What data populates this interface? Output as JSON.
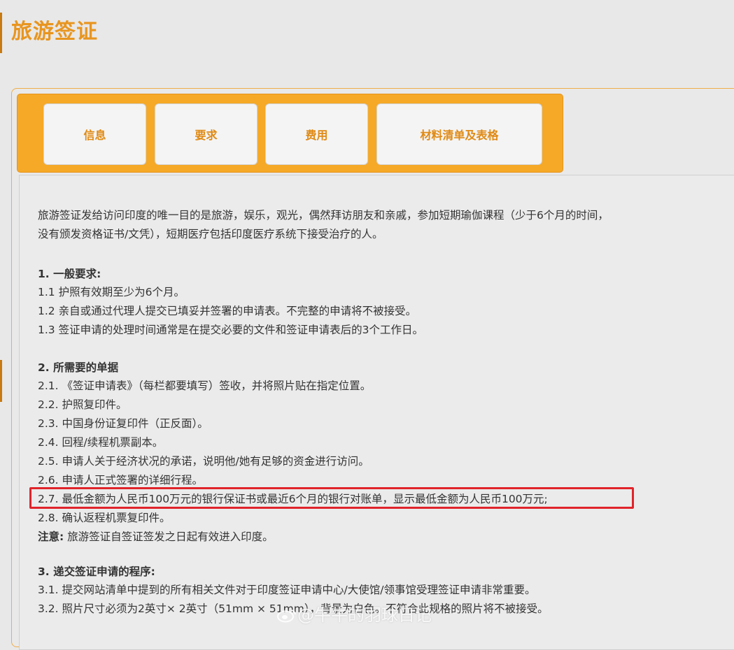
{
  "page": {
    "title": "旅游签证"
  },
  "tabs": [
    {
      "label": "信息"
    },
    {
      "label": "要求"
    },
    {
      "label": "费用"
    },
    {
      "label": "材料清单及表格"
    }
  ],
  "content": {
    "intro_line1": "旅游签证发给访问印度的唯一目的是旅游，娱乐，观光，偶然拜访朋友和亲戚，参加短期瑜伽课程（少于6个月的时间，",
    "intro_line2": "没有颁发资格证书/文凭），短期医疗包括印度医疗系统下接受治疗的人。",
    "section1": {
      "heading": "1. 一般要求:",
      "items": [
        "1.1 护照有效期至少为6个月。",
        "1.2 亲自或通过代理人提交已填妥并签署的申请表。不完整的申请将不被接受。",
        "1.3 签证申请的处理时间通常是在提交必要的文件和签证申请表后的3个工作日。"
      ]
    },
    "section2": {
      "heading": "2. 所需要的单据",
      "items": [
        "2.1. 《签证申请表》（每栏都要填写）签收，并将照片贴在指定位置。",
        "2.2. 护照复印件。",
        "2.3. 中国身份证复印件（正反面）。",
        "2.4. 回程/续程机票副本。",
        "2.5. 申请人关于经济状况的承诺，说明他/她有足够的资金进行访问。",
        "2.6. 申请人正式签署的详细行程。",
        "2.7. 最低金额为人民币100万元的银行保证书或最近6个月的银行对账单，显示最低金额为人民币100万元;",
        "2.8. 确认返程机票复印件。"
      ],
      "note_label": "注意:",
      "note_text": " 旅游签证自签证签发之日起有效进入印度。"
    },
    "section3": {
      "heading": "3. 递交签证申请的程序:",
      "items": [
        "3.1. 提交网站清单中提到的所有相关文件对于印度签证申请中心/大使馆/领事馆受理签证申请非常重要。",
        "3.2. 照片尺寸必须为2英寸× 2英寸（51mm × 51mm），背景为白色。不符合此规格的照片将不被接受。"
      ]
    }
  },
  "watermark": {
    "text": "@牛牛的羽球日记"
  },
  "colors": {
    "accent": "#e8951f",
    "tab_bar": "#f5a927",
    "highlight": "#e0242a"
  }
}
